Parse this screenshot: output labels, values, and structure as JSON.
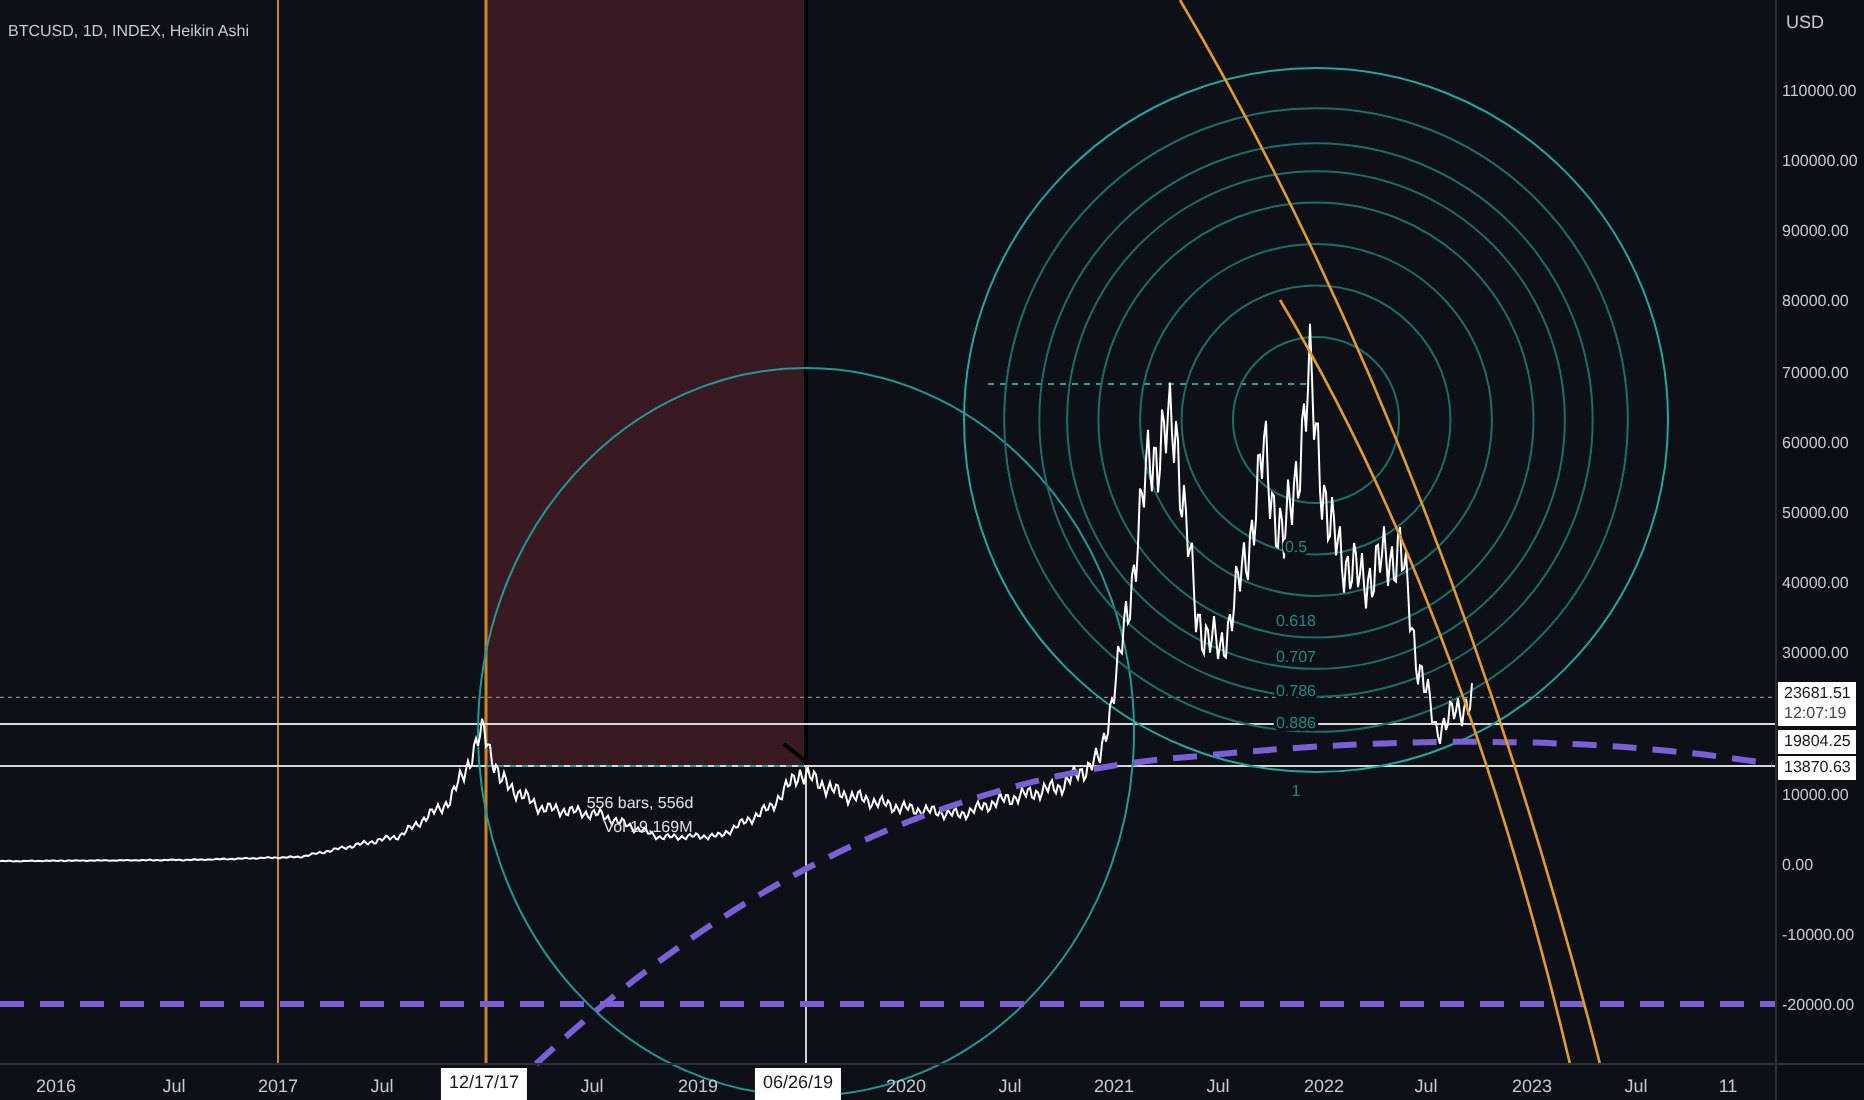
{
  "legend": {
    "title": "BTCUSD, 1D, INDEX, Heikin Ashi"
  },
  "y_axis": {
    "unit": "USD",
    "labels": [
      "110000.00",
      "100000.00",
      "90000.00",
      "80000.00",
      "70000.00",
      "60000.00",
      "50000.00",
      "40000.00",
      "30000.00",
      "10000.00",
      "0.00",
      "-10000.00",
      "-20000.00"
    ]
  },
  "price_tags": [
    {
      "kind": "last",
      "price": "23681.51",
      "time": "12:07:19"
    },
    {
      "kind": "level",
      "price": "19804.25"
    },
    {
      "kind": "level",
      "price": "13870.63"
    }
  ],
  "x_axis": {
    "labels": [
      {
        "text": "2016",
        "selected": false
      },
      {
        "text": "Jul",
        "selected": false
      },
      {
        "text": "2017",
        "selected": false
      },
      {
        "text": "Jul",
        "selected": false
      },
      {
        "text": "12/17/17",
        "selected": true
      },
      {
        "text": "Jul",
        "selected": false
      },
      {
        "text": "2019",
        "selected": false
      },
      {
        "text": "06/26/19",
        "selected": true
      },
      {
        "text": "2020",
        "selected": false
      },
      {
        "text": "Jul",
        "selected": false
      },
      {
        "text": "2021",
        "selected": false
      },
      {
        "text": "Jul",
        "selected": false
      },
      {
        "text": "2022",
        "selected": false
      },
      {
        "text": "Jul",
        "selected": false
      },
      {
        "text": "2023",
        "selected": false
      },
      {
        "text": "Jul",
        "selected": false
      },
      {
        "text": "11",
        "selected": false
      }
    ]
  },
  "measure": {
    "range": "556 bars, 556d",
    "volume": "Vol 19.169M"
  },
  "fib_labels": [
    "0.5",
    "0.618",
    "0.707",
    "0.786",
    "0.886",
    "1"
  ]
}
